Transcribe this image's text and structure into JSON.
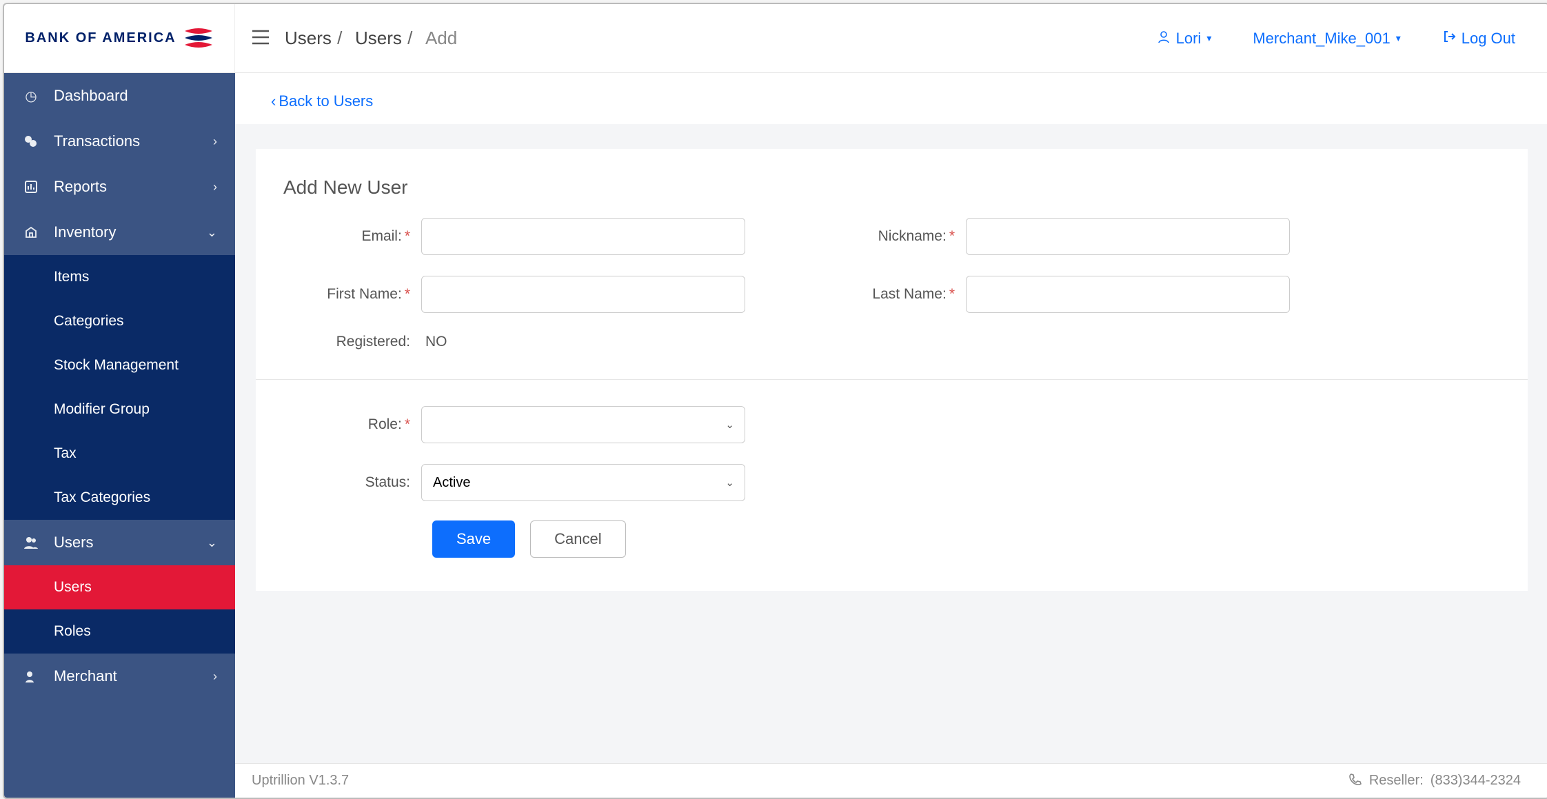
{
  "brand": {
    "name": "BANK OF AMERICA"
  },
  "breadcrumbs": {
    "root": "Users",
    "parent": "Users",
    "current": "Add"
  },
  "topbar": {
    "user": "Lori",
    "merchant": "Merchant_Mike_001",
    "logout": "Log Out"
  },
  "sidebar": {
    "dashboard": "Dashboard",
    "transactions": "Transactions",
    "reports": "Reports",
    "inventory": "Inventory",
    "inventory_items": {
      "items": "Items",
      "categories": "Categories",
      "stock": "Stock Management",
      "modifier": "Modifier Group",
      "tax": "Tax",
      "tax_categories": "Tax Categories"
    },
    "users": "Users",
    "users_items": {
      "users": "Users",
      "roles": "Roles"
    },
    "merchant": "Merchant"
  },
  "back": {
    "label": "Back to Users"
  },
  "form": {
    "title": "Add New User",
    "labels": {
      "email": "Email:",
      "nickname": "Nickname:",
      "first_name": "First Name:",
      "last_name": "Last Name:",
      "registered": "Registered:",
      "role": "Role:",
      "status": "Status:"
    },
    "values": {
      "email": "",
      "nickname": "",
      "first_name": "",
      "last_name": "",
      "registered": "NO",
      "role": "",
      "status": "Active"
    },
    "buttons": {
      "save": "Save",
      "cancel": "Cancel"
    }
  },
  "footer": {
    "version": "Uptrillion V1.3.7",
    "reseller_label": "Reseller:",
    "reseller_phone": "(833)344-2324"
  }
}
